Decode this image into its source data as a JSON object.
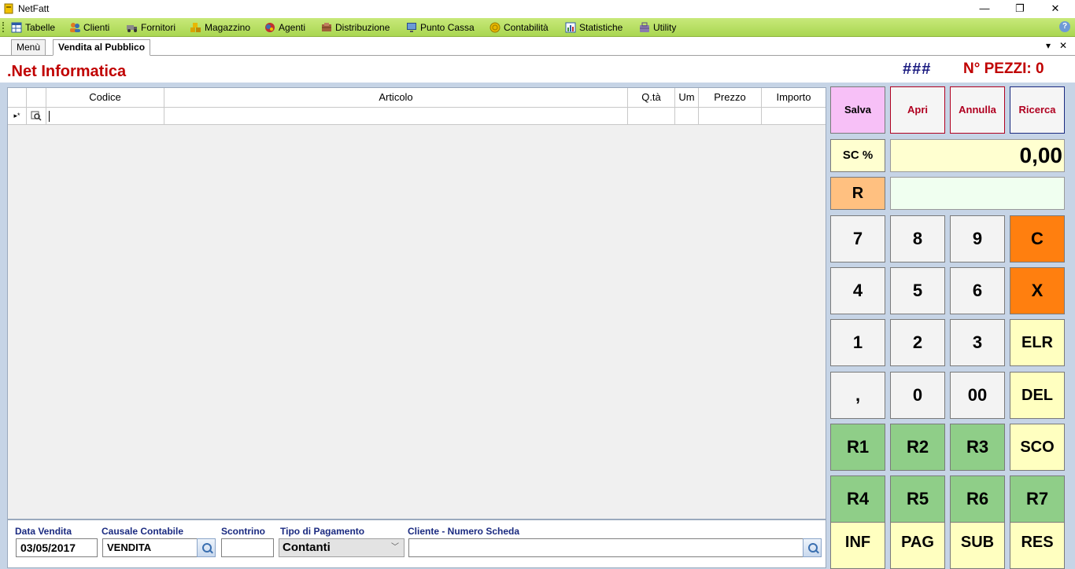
{
  "window": {
    "title": "NetFatt",
    "minimize": "—",
    "maximize": "❐",
    "close": "✕"
  },
  "menu": [
    {
      "label": "Tabelle",
      "icon": "table-icon"
    },
    {
      "label": "Clienti",
      "icon": "users-icon"
    },
    {
      "label": "Fornitori",
      "icon": "truck-icon"
    },
    {
      "label": "Magazzino",
      "icon": "boxes-icon"
    },
    {
      "label": "Agenti",
      "icon": "agent-icon"
    },
    {
      "label": "Distribuzione",
      "icon": "distribution-icon"
    },
    {
      "label": "Punto Cassa",
      "icon": "monitor-icon"
    },
    {
      "label": "Contabilità",
      "icon": "coin-icon"
    },
    {
      "label": "Statistiche",
      "icon": "chart-icon"
    },
    {
      "label": "Utility",
      "icon": "utility-icon"
    }
  ],
  "help": "?",
  "tabs": {
    "menu": "Menù",
    "active": "Vendita al Pubblico",
    "dropdown": "▾",
    "close": "✕"
  },
  "header": {
    "company": ".Net Informatica",
    "hash": "###",
    "pezzi": "N° PEZZI: 0"
  },
  "grid": {
    "columns": [
      "",
      "",
      "Codice",
      "Articolo",
      "Q.tà",
      "Um",
      "Prezzo",
      "Importo"
    ],
    "new_row_marker": "▸*"
  },
  "bottom": {
    "data_label": "Data Vendita",
    "data_value": "03/05/2017",
    "causale_label": "Causale Contabile",
    "causale_value": "VENDITA",
    "scontrino_label": "Scontrino",
    "scontrino_value": "",
    "pagamento_label": "Tipo di Pagamento",
    "pagamento_value": "Contanti",
    "cliente_label": "Cliente - Numero Scheda",
    "cliente_value": ""
  },
  "keypad": {
    "salva": "Salva",
    "apri": "Apri",
    "annulla": "Annulla",
    "ricerca": "Ricerca",
    "sc": "SC %",
    "display": "0,00",
    "r": "R",
    "k7": "7",
    "k8": "8",
    "k9": "9",
    "kc": "C",
    "k4": "4",
    "k5": "5",
    "k6": "6",
    "kx": "X",
    "k1": "1",
    "k2": "2",
    "k3": "3",
    "elr": "ELR",
    "comma": ",",
    "k0": "0",
    "k00": "00",
    "del": "DEL",
    "r1": "R1",
    "r2": "R2",
    "r3": "R3",
    "sco": "SCO",
    "r4": "R4",
    "r5": "R5",
    "r6": "R6",
    "r7": "R7",
    "inf": "INF",
    "pag": "PAG",
    "sub": "SUB",
    "res": "RES"
  },
  "colors": {
    "menubar": "#b5dd5e",
    "accent_red": "#c00000",
    "keypad_orange": "#ff7f0f",
    "keypad_green": "#8fce88",
    "keypad_yellow": "#ffffc0",
    "salva_pink": "#f7c0f7"
  }
}
